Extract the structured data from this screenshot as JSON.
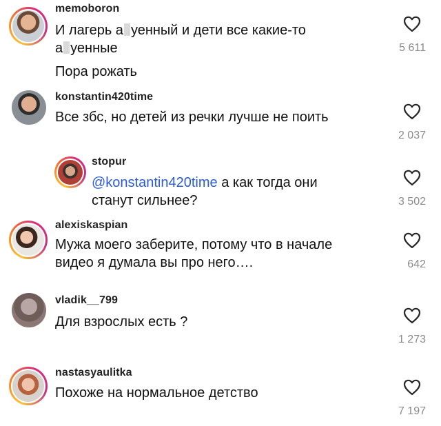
{
  "comments": [
    {
      "username": "memoboron",
      "text_line1_a": "И лагерь а",
      "text_line1_b": "уенный и дети все какие-то",
      "text_line2_a": "а",
      "text_line2_b": "уенные",
      "text_line3": "Пора рожать",
      "likes": "5 611"
    },
    {
      "username": "konstantin420time",
      "text": "Все збс, но детей из речки лучше не поить",
      "likes": "2 037"
    },
    {
      "username": "stopur",
      "mention": "@konstantin420time",
      "text_line1": " а как тогда они",
      "text_line2": "станут сильнее?",
      "likes": "3 502"
    },
    {
      "username": "alexiskaspian",
      "text_line1": "Мужа моего заберите, потому что в начале",
      "text_line2": "видео я думала вы про него….",
      "likes": "642"
    },
    {
      "username": "vladik__799",
      "text": "Для взрослых есть ?",
      "likes": "1 273"
    },
    {
      "username": "nastasyaulitka",
      "text": "Похоже на нормальное детство",
      "likes": "7 197"
    }
  ],
  "icons": {
    "like": "heart-outline-icon"
  },
  "colors": {
    "mention": "#2a5bd7",
    "count": "#8a8a8a",
    "story_ring": "#dd2a7b"
  }
}
